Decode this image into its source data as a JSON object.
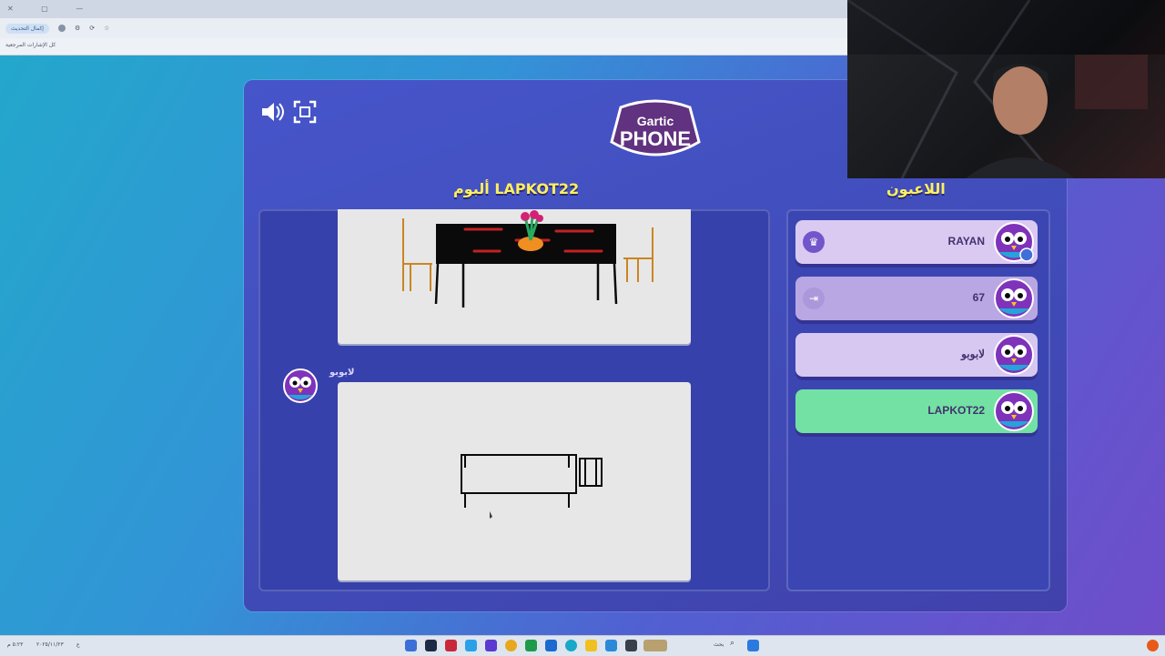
{
  "browser": {
    "update_pill": "إكمال التحديث",
    "bookmarks_label": "كل الإشارات المرجعية"
  },
  "game": {
    "logo_top": "Gartic",
    "logo_bottom": "PHONE",
    "album_title": "ألبوم LAPKOT22",
    "players_title": "اللاعبون",
    "drawing_author": "لابوبو",
    "players": [
      {
        "name": "RAYAN",
        "badge": "crown-icon",
        "color": "#d9c8f2"
      },
      {
        "name": "67",
        "badge": "exit-icon",
        "color": "#b7a4e2"
      },
      {
        "name": "لابوبو",
        "badge": "",
        "color": "#d6c6f1"
      },
      {
        "name": "LAPKOT22",
        "badge": "",
        "color": "#6ee0a0"
      }
    ]
  },
  "taskbar": {
    "search_label": "بحث",
    "clock_time": "٥:٢٣ م",
    "clock_date": "٢٠٢٥/١١/٢٣",
    "lang": "ع"
  },
  "colors": {
    "heading_yellow": "#ffef5a",
    "panel_blue": "#3f4fc8",
    "active_green": "#6ee0a0"
  }
}
